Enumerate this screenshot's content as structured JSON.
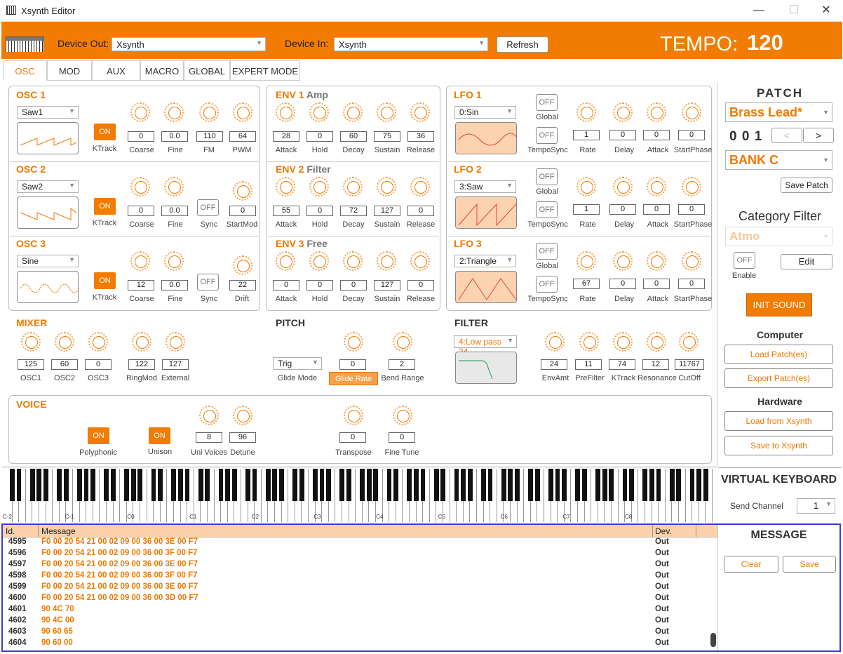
{
  "window": {
    "title": "Xsynth Editor",
    "minimize": "—",
    "maximize": "☐",
    "close": "✕"
  },
  "header": {
    "device_out_label": "Device Out:",
    "device_out_value": "Xsynth",
    "device_in_label": "Device In:",
    "device_in_value": "Xsynth",
    "refresh_label": "Refresh",
    "tempo_label": "TEMPO:",
    "tempo_value": "120"
  },
  "tabs": [
    "OSC",
    "MOD",
    "AUX",
    "MACRO",
    "GLOBAL",
    "EXPERT MODE"
  ],
  "osc": [
    {
      "title": "OSC 1",
      "wave": "Saw1",
      "ktrack": "ON",
      "coarse": "0",
      "fine": "0.0",
      "p3_val": "110",
      "p3_lbl": "FM",
      "p4_val": "64",
      "p4_lbl": "PWM",
      "ktrack_lbl": "KTrack"
    },
    {
      "title": "OSC 2",
      "wave": "Saw2",
      "ktrack": "ON",
      "coarse": "0",
      "fine": "0.0",
      "p3_val": "OFF",
      "p3_lbl": "Sync",
      "p4_val": "0",
      "p4_lbl": "StartMod",
      "ktrack_lbl": "KTrack"
    },
    {
      "title": "OSC 3",
      "wave": "Sine",
      "ktrack": "ON",
      "coarse": "12",
      "fine": "0.0",
      "p3_val": "OFF",
      "p3_lbl": "Sync",
      "p4_val": "22",
      "p4_lbl": "Drift",
      "ktrack_lbl": "KTrack"
    }
  ],
  "osc_labels": {
    "coarse": "Coarse",
    "fine": "Fine"
  },
  "env": [
    {
      "title": "ENV 1",
      "sub": "Amp",
      "values": [
        "28",
        "0",
        "60",
        "75",
        "36"
      ]
    },
    {
      "title": "ENV 2",
      "sub": "Filter",
      "values": [
        "55",
        "0",
        "72",
        "127",
        "0"
      ]
    },
    {
      "title": "ENV 3",
      "sub": "Free",
      "values": [
        "0",
        "0",
        "0",
        "127",
        "0"
      ]
    }
  ],
  "env_labels": [
    "Attack",
    "Hold",
    "Decay",
    "Sustain",
    "Release"
  ],
  "lfo": [
    {
      "title": "LFO 1",
      "wave": "0:Sin",
      "global": "OFF",
      "temposync": "OFF",
      "values": [
        "1",
        "0",
        "0",
        "0"
      ]
    },
    {
      "title": "LFO 2",
      "wave": "3:Saw",
      "global": "OFF",
      "temposync": "OFF",
      "values": [
        "1",
        "0",
        "0",
        "0"
      ]
    },
    {
      "title": "LFO 3",
      "wave": "2:Triangle",
      "global": "OFF",
      "temposync": "OFF",
      "values": [
        "67",
        "0",
        "0",
        "0"
      ]
    }
  ],
  "lfo_labels": {
    "global": "Global",
    "temposync": "TempoSync",
    "params": [
      "Rate",
      "Delay",
      "Attack",
      "StartPhase"
    ]
  },
  "mixer": {
    "title": "MIXER",
    "values": [
      "125",
      "60",
      "0",
      "122",
      "127"
    ],
    "labels": [
      "OSC1",
      "OSC2",
      "OSC3",
      "RingMod",
      "External"
    ]
  },
  "pitch": {
    "title": "PITCH",
    "glide_mode": "Trig",
    "glide_mode_lbl": "Glide Mode",
    "glide_rate": "0",
    "glide_rate_lbl": "Glide Rate",
    "bend_range": "2",
    "bend_range_lbl": "Bend Range"
  },
  "filter": {
    "title": "FILTER",
    "type": "4:Low pass 24",
    "values": [
      "24",
      "11",
      "74",
      "12",
      "11767"
    ],
    "labels": [
      "EnvAmt",
      "PreFilter",
      "KTrack",
      "Resonance",
      "CutOff"
    ]
  },
  "voice": {
    "title": "VOICE",
    "poly": "ON",
    "poly_lbl": "Polyphonic",
    "unison": "ON",
    "unison_lbl": "Unison",
    "uni_voices": "8",
    "uni_voices_lbl": "Uni Voices",
    "detune": "96",
    "detune_lbl": "Detune",
    "transpose": "0",
    "transpose_lbl": "Transpose",
    "finetune": "0",
    "finetune_lbl": "Fine Tune"
  },
  "patch": {
    "title": "PATCH",
    "name": "Brass Lead*",
    "number": "0 0 1",
    "prev": "<",
    "next": ">",
    "bank": "BANK C",
    "save_label": "Save Patch",
    "category_title": "Category Filter",
    "category_value": "Atmo",
    "enable_btn": "OFF",
    "enable_lbl": "Enable",
    "edit_label": "Edit",
    "init_label": "INIT  SOUND",
    "computer_title": "Computer",
    "load_patches": "Load Patch(es)",
    "export_patches": "Export Patch(es)",
    "hardware_title": "Hardware",
    "load_from": "Load from Xsynth",
    "save_to": "Save to Xsynth"
  },
  "keyboard": {
    "title": "VIRTUAL KEYBOARD",
    "send_channel_lbl": "Send Channel",
    "send_channel": "1",
    "octave_labels": [
      "C-2",
      "C-1",
      "C0",
      "C1",
      "C2",
      "C3",
      "C4",
      "C5",
      "C6",
      "C7",
      "C8"
    ]
  },
  "messages": {
    "title": "MESSAGE",
    "clear": "Clear",
    "save": "Save",
    "columns": [
      "Id.",
      "Message",
      "Dev."
    ],
    "rows": [
      {
        "id": "4595",
        "msg": "F0 00 20 54 21 00 02 09 00 36 00 3E 00 F7",
        "dev": "Out"
      },
      {
        "id": "4596",
        "msg": "F0 00 20 54 21 00 02 09 00 36 00 3F 00 F7",
        "dev": "Out"
      },
      {
        "id": "4597",
        "msg": "F0 00 20 54 21 00 02 09 00 36 00 3E 00 F7",
        "dev": "Out"
      },
      {
        "id": "4598",
        "msg": "F0 00 20 54 21 00 02 09 00 36 00 3F 00 F7",
        "dev": "Out"
      },
      {
        "id": "4599",
        "msg": "F0 00 20 54 21 00 02 09 00 36 00 3E 00 F7",
        "dev": "Out"
      },
      {
        "id": "4600",
        "msg": "F0 00 20 54 21 00 02 09 00 36 00 3D 00 F7",
        "dev": "Out"
      },
      {
        "id": "4601",
        "msg": "90 4C 70",
        "dev": "Out"
      },
      {
        "id": "4602",
        "msg": "90 4C 00",
        "dev": "Out"
      },
      {
        "id": "4603",
        "msg": "90 60 65",
        "dev": "Out"
      },
      {
        "id": "4604",
        "msg": "90 60 00",
        "dev": "Out"
      }
    ]
  }
}
